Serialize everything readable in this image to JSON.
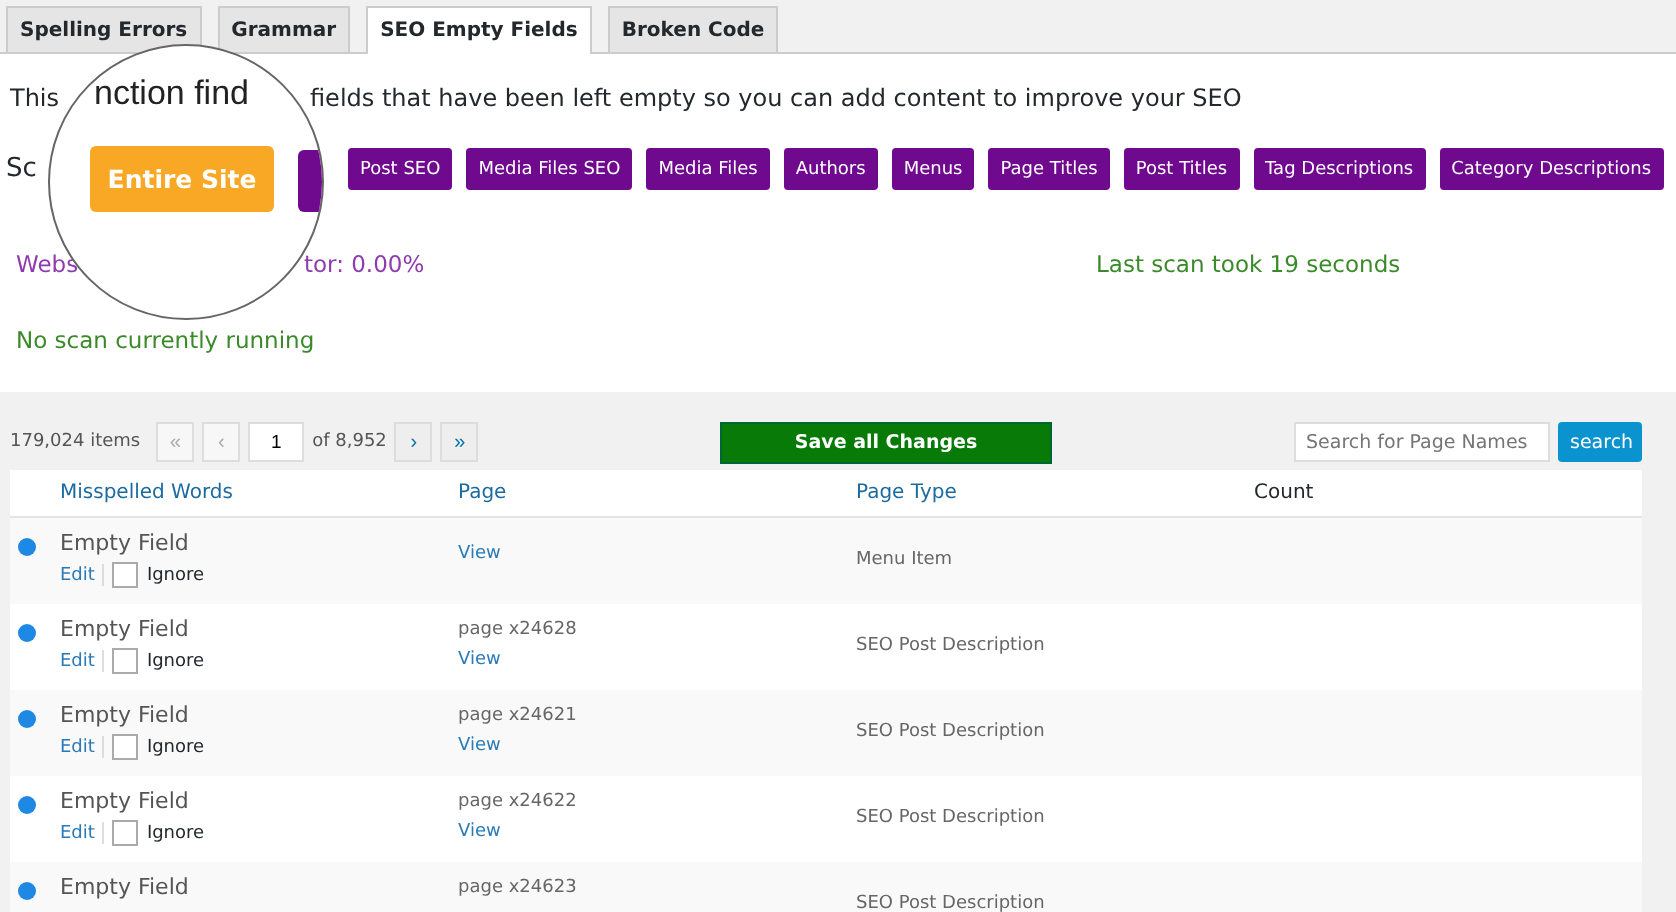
{
  "tabs": [
    {
      "label": "Spelling Errors",
      "selected": false
    },
    {
      "label": "Grammar",
      "selected": false
    },
    {
      "label": "SEO Empty Fields",
      "selected": true
    },
    {
      "label": "Broken Code",
      "selected": false
    }
  ],
  "description": {
    "start": "This",
    "rest": "fields that have been left empty so you can add content to improve your SEO"
  },
  "scan": {
    "label": "Sc",
    "buttons": [
      "Post SEO",
      "Media Files SEO",
      "Media Files",
      "Authors",
      "Menus",
      "Page Titles",
      "Post Titles",
      "Tag Descriptions",
      "Category Descriptions"
    ]
  },
  "magnifier": {
    "heading": "nction find",
    "button": "Entire Site"
  },
  "status": {
    "website_start": "Webs",
    "website_end": "tor: 0.00%",
    "last_scan": "Last scan took 19 seconds",
    "running": "No scan currently running"
  },
  "pagination": {
    "items": "179,024 items",
    "first": "«",
    "prev": "‹",
    "page": "1",
    "of": "of 8,952",
    "next": "›",
    "last": "»"
  },
  "save_button": "Save all Changes",
  "search": {
    "placeholder": "Search for Page Names",
    "button": "search"
  },
  "columns": [
    "Misspelled Words",
    "Page",
    "Page Type",
    "Count"
  ],
  "rows": [
    {
      "word": "Empty Field",
      "edit": "Edit",
      "ignore": "Ignore",
      "checked": false,
      "view": "View",
      "type": "Menu Item"
    },
    {
      "word": "Empty Field",
      "edit": "Edit",
      "ignore": "Ignore",
      "checked": false,
      "page": "page x24628",
      "view": "View",
      "type": "SEO Post Description"
    },
    {
      "word": "Empty Field",
      "edit": "Edit",
      "ignore": "Ignore",
      "checked": false,
      "page": "page x24621",
      "view": "View",
      "type": "SEO Post Description"
    },
    {
      "word": "Empty Field",
      "edit": "Edit",
      "ignore": "Ignore",
      "checked": false,
      "page": "page x24622",
      "view": "View",
      "type": "SEO Post Description"
    },
    {
      "word": "Empty Field",
      "page": "page x24623",
      "type": "SEO Post Description"
    }
  ]
}
